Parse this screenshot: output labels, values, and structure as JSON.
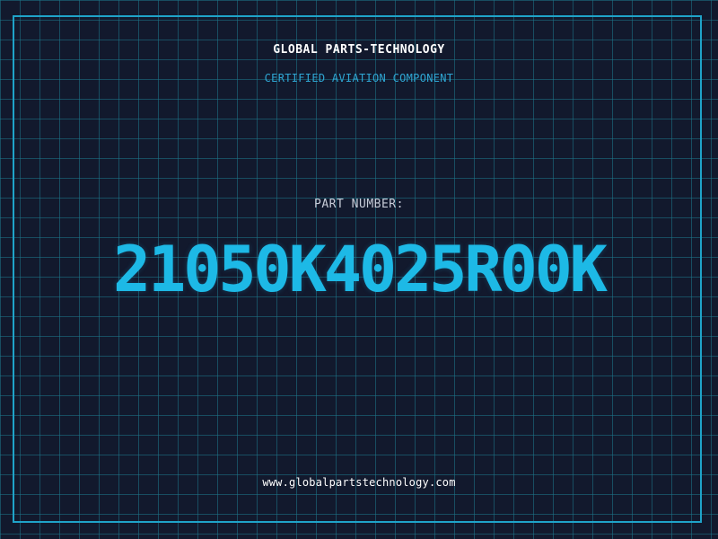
{
  "header": {
    "company": "GLOBAL PARTS-TECHNOLOGY",
    "subtitle": "CERTIFIED AVIATION COMPONENT"
  },
  "part": {
    "label": "PART NUMBER:",
    "number": "21050K4025R00K"
  },
  "footer": {
    "url": "www.globalpartstechnology.com"
  },
  "colors": {
    "background": "#12192d",
    "grid": "#1e788c",
    "frame": "#1fa3c9",
    "accent": "#1db9e6"
  }
}
